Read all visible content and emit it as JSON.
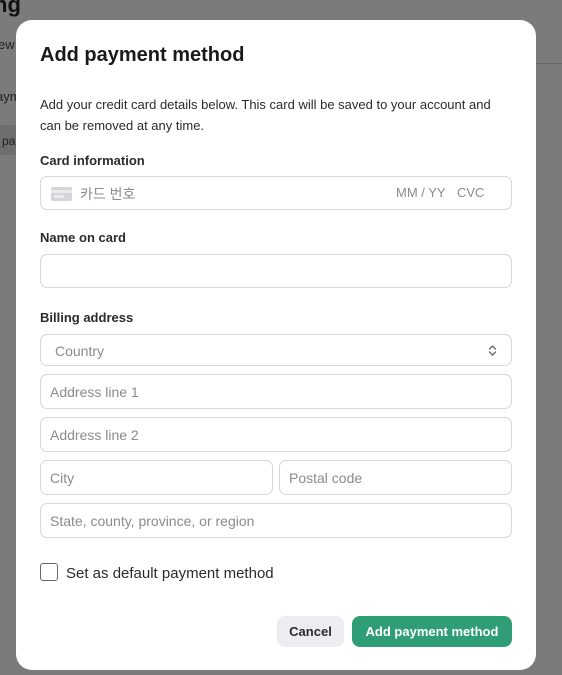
{
  "background": {
    "title_fragment": "ng",
    "subtitle_fragment": "ew",
    "item_fragment": "aym",
    "chip_fragment": "pa"
  },
  "modal": {
    "title": "Add payment method",
    "description": "Add your credit card details below. This card will be saved to your account and can be removed at any time.",
    "card_label": "Card information",
    "card_number_placeholder": "카드 번호",
    "card_expiry_placeholder": "MM / YY",
    "card_cvc_placeholder": "CVC",
    "name_label": "Name on card",
    "name_value": "",
    "billing_label": "Billing address",
    "country_placeholder": "Country",
    "address1_placeholder": "Address line 1",
    "address2_placeholder": "Address line 2",
    "city_placeholder": "City",
    "postal_placeholder": "Postal code",
    "state_placeholder": "State, county, province, or region",
    "default_checkbox_label": "Set as default payment method",
    "default_checked": false,
    "cancel_label": "Cancel",
    "submit_label": "Add payment method"
  },
  "colors": {
    "primary": "#2f9e77",
    "overlay": "#7b7b7b"
  }
}
